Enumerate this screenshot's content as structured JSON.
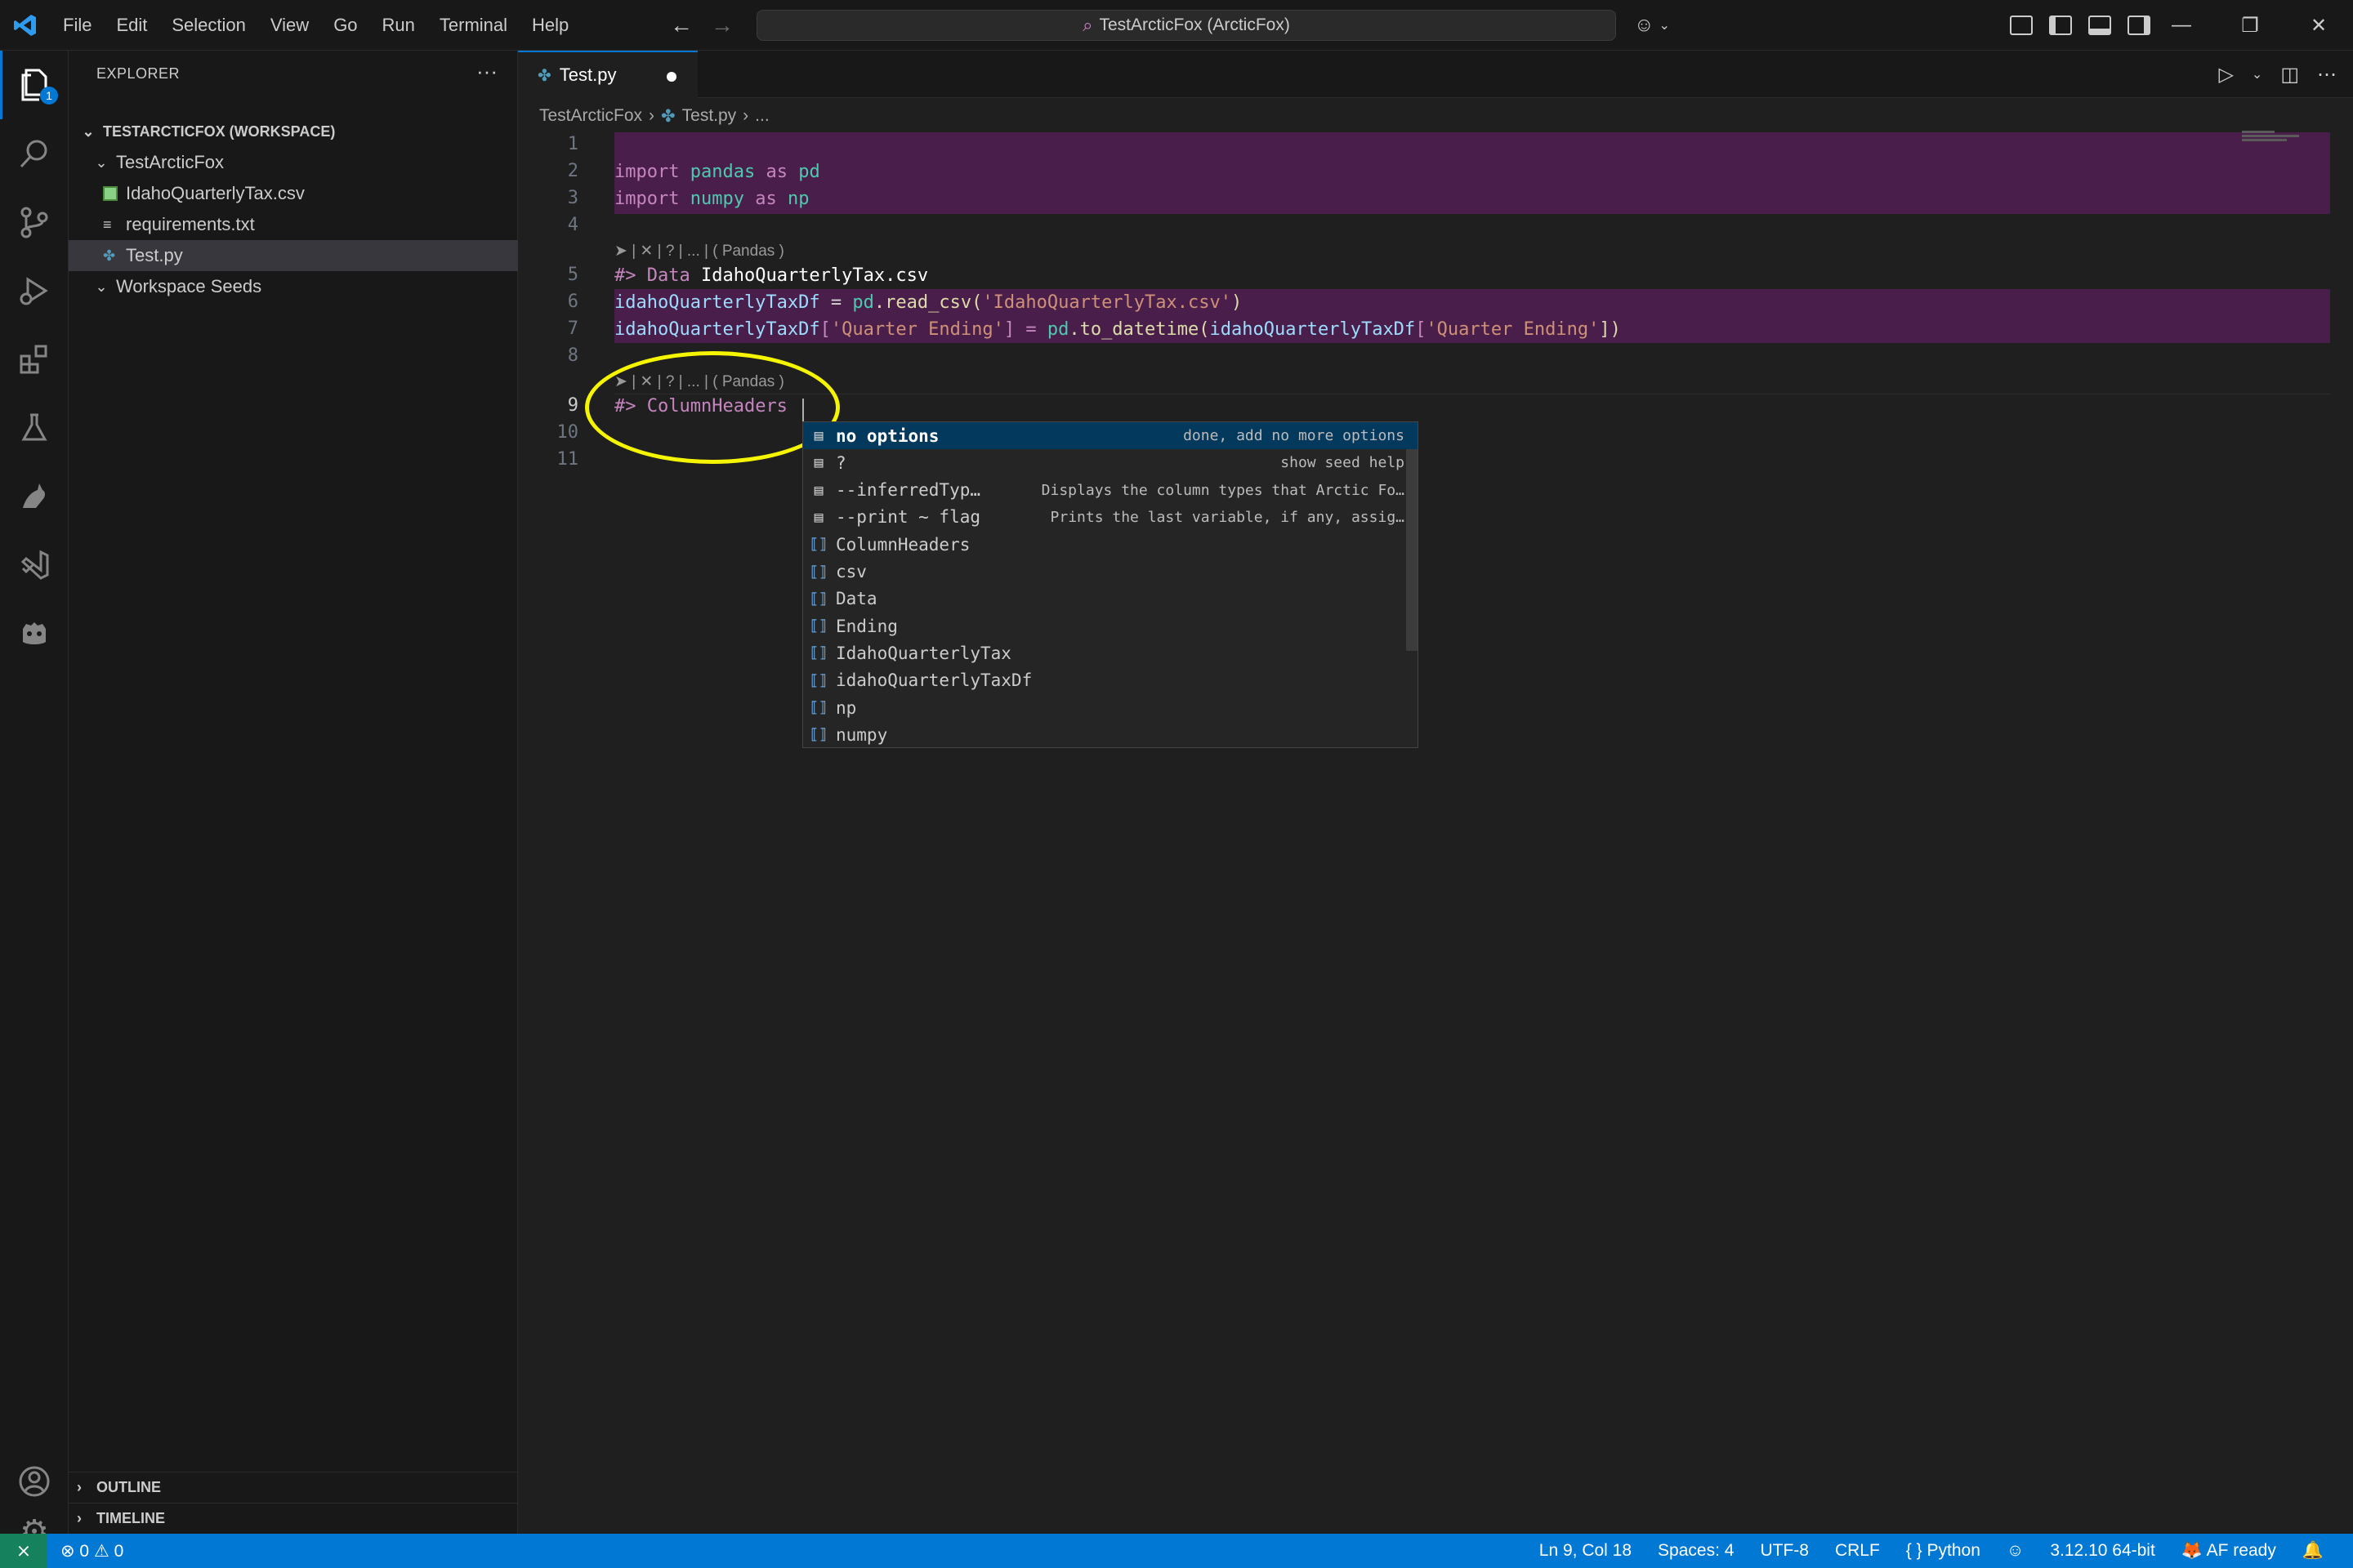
{
  "titlebar": {
    "menus": [
      "File",
      "Edit",
      "Selection",
      "View",
      "Go",
      "Run",
      "Terminal",
      "Help"
    ],
    "command_center": "TestArcticFox (ArcticFox)"
  },
  "activity_bar": {
    "explorer_badge": "1"
  },
  "sidebar": {
    "title": "EXPLORER",
    "workspace": "TESTARCTICFOX (WORKSPACE)",
    "folder": "TestArcticFox",
    "files": [
      "IdahoQuarterlyTax.csv",
      "requirements.txt",
      "Test.py"
    ],
    "seeds_folder": "Workspace Seeds",
    "outline": "OUTLINE",
    "timeline": "TIMELINE"
  },
  "editor": {
    "tab_label": "Test.py",
    "breadcrumb": [
      "TestArcticFox",
      "Test.py",
      "..."
    ],
    "line_numbers": [
      "1",
      "2",
      "3",
      "4",
      "5",
      "6",
      "7",
      "8",
      "9",
      "10",
      "11"
    ],
    "lens_text": "➤ | ✕ | ? | ... | ( Pandas )",
    "lines": {
      "l2": {
        "kw1": "import",
        "mod": " pandas",
        "kw2": " as",
        "alias": " pd"
      },
      "l3": {
        "kw1": "import",
        "mod": " numpy",
        "kw2": " as",
        "alias": " np"
      },
      "l5": {
        "mark": "#>",
        "cmd": " Data",
        "arg": " IdahoQuarterlyTax.csv"
      },
      "l6": {
        "var": "idahoQuarterlyTaxDf",
        "eq": " = ",
        "mod": "pd",
        "fn": ".read_csv(",
        "str": "'IdahoQuarterlyTax.csv'",
        "close": ")"
      },
      "l7": {
        "var": "idahoQuarterlyTaxDf",
        "b1": "[",
        "str1": "'Quarter Ending'",
        "b2": "] = ",
        "mod": "pd",
        "fn": ".to_datetime(",
        "var2": "idahoQuarterlyTaxDf",
        "b3": "[",
        "str2": "'Quarter Ending'",
        "b4": "])"
      },
      "l9": {
        "mark": "#>",
        "cmd": " ColumnHeaders"
      }
    }
  },
  "suggest": {
    "items": [
      {
        "label": "no options",
        "detail": "done, add no more options",
        "kind": "snippet"
      },
      {
        "label": "?",
        "detail": "show seed help",
        "kind": "snippet"
      },
      {
        "label": "--inferredTyp…",
        "detail": "Displays the column types that Arctic Fo…",
        "kind": "snippet"
      },
      {
        "label": "--print ~ flag",
        "detail": "Prints the last variable, if any, assig…",
        "kind": "snippet"
      },
      {
        "label": "ColumnHeaders",
        "detail": "",
        "kind": "variable"
      },
      {
        "label": "csv",
        "detail": "",
        "kind": "variable"
      },
      {
        "label": "Data",
        "detail": "",
        "kind": "variable"
      },
      {
        "label": "Ending",
        "detail": "",
        "kind": "variable"
      },
      {
        "label": "IdahoQuarterlyTax",
        "detail": "",
        "kind": "variable"
      },
      {
        "label": "idahoQuarterlyTaxDf",
        "detail": "",
        "kind": "variable"
      },
      {
        "label": "np",
        "detail": "",
        "kind": "variable"
      },
      {
        "label": "numpy",
        "detail": "",
        "kind": "variable"
      }
    ]
  },
  "statusbar": {
    "problems": "⊗ 0 ⚠ 0",
    "position": "Ln 9, Col 18",
    "spaces": "Spaces: 4",
    "encoding": "UTF-8",
    "eol": "CRLF",
    "language": "Python",
    "interpreter": "3.12.10 64-bit",
    "af_status": "AF ready"
  },
  "colors": {
    "accent": "#0078d4",
    "highlight_block": "#4a1e4a",
    "annotation_circle": "#f5f500"
  }
}
